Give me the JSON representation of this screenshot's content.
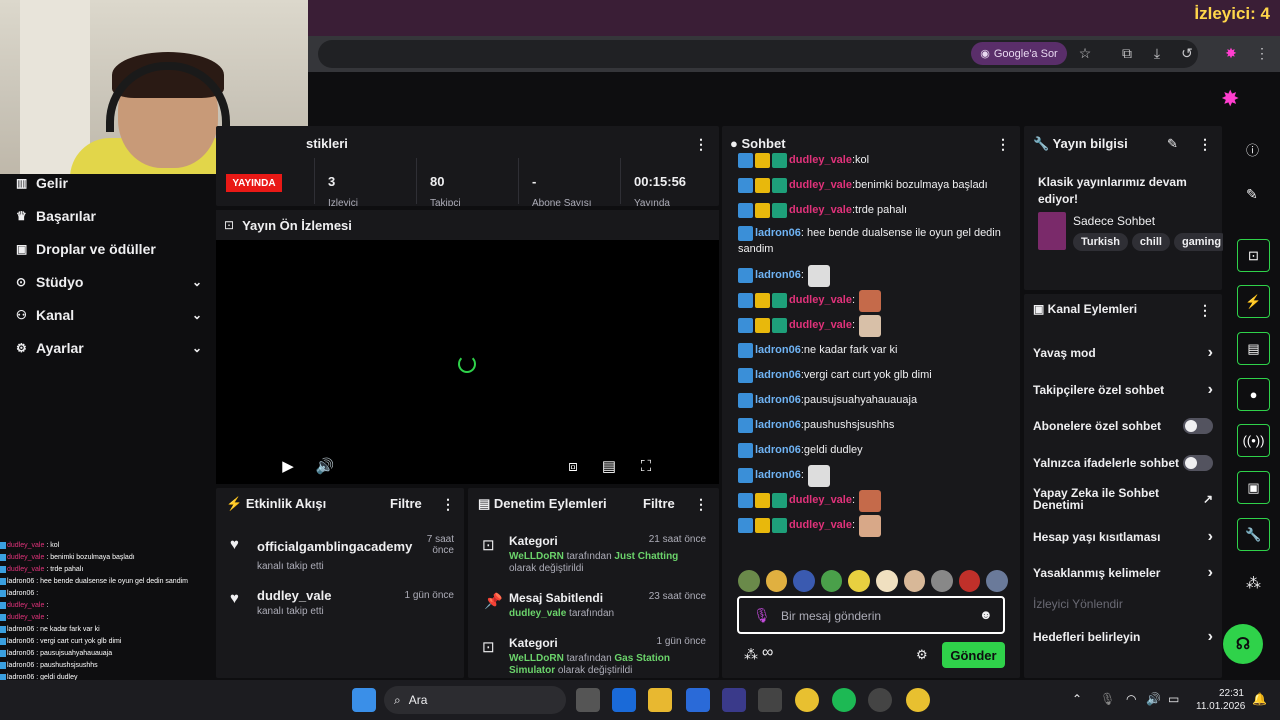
{
  "browser": {
    "viewer_count": "İzleyici: 4",
    "google_ask": "Google'a Sor",
    "icons": [
      "star-icon",
      "extensions-icon",
      "download-icon",
      "history-icon",
      "profile-icon",
      "more-icon"
    ]
  },
  "sidebar": {
    "items": [
      {
        "label": "Gelir",
        "icon": "revenue-icon"
      },
      {
        "label": "Başarılar",
        "icon": "trophy-icon"
      },
      {
        "label": "Droplar ve ödüller",
        "icon": "gift-icon"
      },
      {
        "label": "Stüdyo",
        "icon": "studio-icon"
      },
      {
        "label": "Kanal",
        "icon": "users-icon"
      },
      {
        "label": "Ayarlar",
        "icon": "gear-icon"
      }
    ]
  },
  "stats": {
    "title": "stikleri",
    "live_badge": "YAYINDA",
    "values": [
      "3",
      "80",
      "-",
      "00:15:56"
    ],
    "labels": [
      "İzleyici",
      "Takipçi",
      "Abone Sayısı",
      "Yayında"
    ]
  },
  "preview": {
    "title": "Yayın Ön İzlemesi"
  },
  "activity": {
    "title": "Etkinlik Akışı",
    "filter": "Filtre",
    "items": [
      {
        "name": "officialgamblingacademy",
        "sub": "kanalı takip etti",
        "time": "7 saat önce"
      },
      {
        "name": "dudley_vale",
        "sub": "kanalı takip etti",
        "time": "1 gün önce"
      }
    ]
  },
  "moderation": {
    "title": "Denetim Eylemleri",
    "filter": "Filtre",
    "items": [
      {
        "title": "Kategori",
        "time": "21 saat önce",
        "actor": "WeLLDoRN",
        "mid": " tarafından ",
        "target": "Just Chatting",
        "tail": "olarak değiştirildi"
      },
      {
        "title": "Mesaj Sabitlendi",
        "time": "23 saat önce",
        "actor": "dudley_vale",
        "mid": " tarafından",
        "target": "",
        "tail": ""
      },
      {
        "title": "Kategori",
        "time": "1 gün önce",
        "actor": "WeLLDoRN",
        "mid": " tarafından ",
        "target": "Gas Station Simulator",
        "tail": "olarak değiştirildi"
      }
    ]
  },
  "chat": {
    "title": "Sohbet",
    "messages": [
      {
        "user": "dudley_vale",
        "text": "kol",
        "badges": 3
      },
      {
        "user": "dudley_vale",
        "text": "benimki bozulmaya başladı",
        "badges": 3
      },
      {
        "user": "dudley_vale",
        "text": "trde pahalı",
        "badges": 3
      },
      {
        "user": "ladron06",
        "text": "hee bende dualsense ile oyun gel dedin sandim",
        "badges": 1
      },
      {
        "user": "ladron06",
        "text": "",
        "badges": 1,
        "emote": "#ddd"
      },
      {
        "user": "dudley_vale",
        "text": "",
        "badges": 3,
        "emote": "#c56a4a"
      },
      {
        "user": "dudley_vale",
        "text": "",
        "badges": 3,
        "emote": "#d8c0a8"
      },
      {
        "user": "ladron06",
        "text": "ne kadar fark var ki",
        "badges": 1
      },
      {
        "user": "ladron06",
        "text": "vergi cart curt yok glb dimi",
        "badges": 1
      },
      {
        "user": "ladron06",
        "text": "pausujsuahyahauauaja",
        "badges": 1
      },
      {
        "user": "ladron06",
        "text": "paushushsjsushhs",
        "badges": 1
      },
      {
        "user": "ladron06",
        "text": "geldi dudley",
        "badges": 1
      },
      {
        "user": "ladron06",
        "text": "",
        "badges": 1,
        "emote": "#ddd"
      },
      {
        "user": "dudley_vale",
        "text": "",
        "badges": 3,
        "emote": "#c56a4a"
      },
      {
        "user": "dudley_vale",
        "text": "",
        "badges": 3,
        "emote": "#d8a888"
      }
    ],
    "input_placeholder": "Bir mesaj gönderin",
    "send_label": "Gönder",
    "points": "∞"
  },
  "stream_info": {
    "title": "Yayın bilgisi",
    "stream_title": "Klasik yayınlarımız devam ediyor!",
    "category": "Sadece Sohbet",
    "tags": [
      "Turkish",
      "chill",
      "gaming"
    ]
  },
  "channel_actions": {
    "title": "Kanal Eylemleri",
    "items": [
      {
        "label": "Yavaş mod",
        "type": "chevron"
      },
      {
        "label": "Takipçilere özel sohbet",
        "type": "chevron"
      },
      {
        "label": "Abonelere özel sohbet",
        "type": "toggle"
      },
      {
        "label": "Yalnızca ifadelerle sohbet",
        "type": "toggle"
      },
      {
        "label": "Yapay Zeka ile Sohbet Denetimi",
        "type": "external"
      },
      {
        "label": "Hesap yaşı kısıtlaması",
        "type": "chevron"
      },
      {
        "label": "Yasaklanmış kelimeler",
        "type": "chevron"
      },
      {
        "label": "İzleyici Yönlendir",
        "type": "disabled"
      },
      {
        "label": "Hedefleri belirleyin",
        "type": "chevron"
      }
    ]
  },
  "overlay_chat": [
    {
      "u": "dudley_vale",
      "t": "kol"
    },
    {
      "u": "dudley_vale",
      "t": "benimki bozulmaya başladı"
    },
    {
      "u": "dudley_vale",
      "t": "trde pahalı"
    },
    {
      "u": "ladron06",
      "t": "hee bende dualsense ile oyun gel dedin sandim"
    },
    {
      "u": "ladron06",
      "t": ""
    },
    {
      "u": "dudley_vale",
      "t": ""
    },
    {
      "u": "dudley_vale",
      "t": ""
    },
    {
      "u": "ladron06",
      "t": "ne kadar fark var ki"
    },
    {
      "u": "ladron06",
      "t": "vergi cart curt yok glb dimi"
    },
    {
      "u": "ladron06",
      "t": "pausujsuahyahauauaja"
    },
    {
      "u": "ladron06",
      "t": "paushushsjsushhs"
    },
    {
      "u": "ladron06",
      "t": "geldi dudley"
    },
    {
      "u": "ladron06",
      "t": ""
    },
    {
      "u": "dudley_vale",
      "t": ""
    },
    {
      "u": "dudley_vale",
      "t": ""
    }
  ],
  "taskbar": {
    "search": "Ara",
    "time": "22:31",
    "date": "11.01.2026"
  },
  "colors": {
    "accent": "#2fd24a",
    "live": "#e91916",
    "dudley": "#e0327a",
    "ladron": "#6fb3f4"
  }
}
